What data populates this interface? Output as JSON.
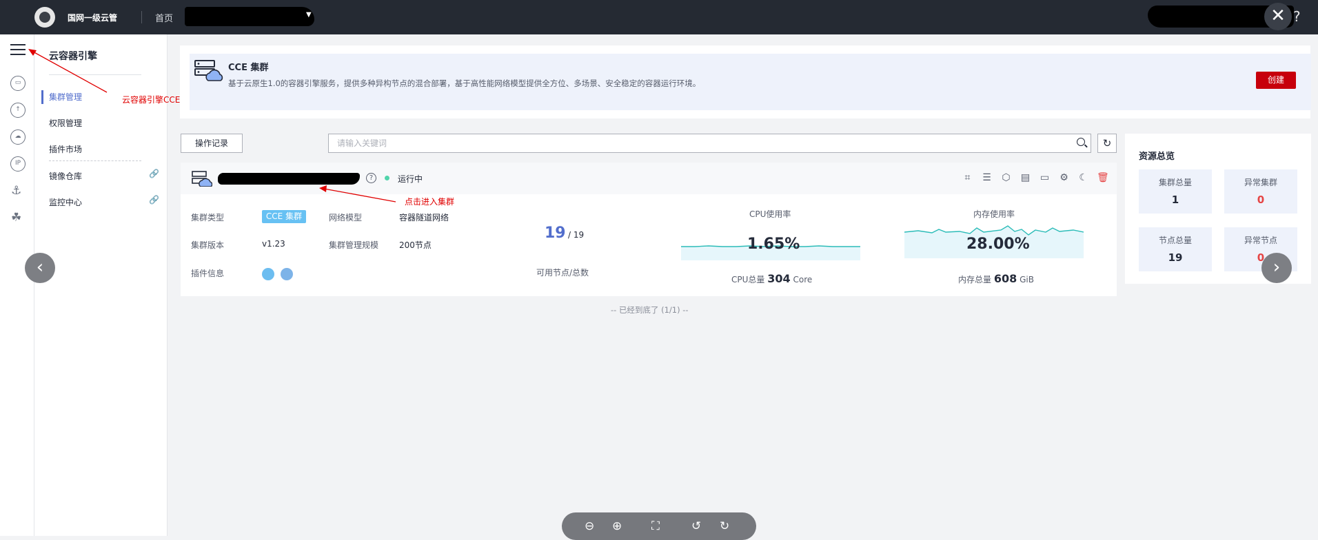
{
  "topbar": {
    "brand": "国网一级云管",
    "home": "首页"
  },
  "sidebar": {
    "title": "云容器引擎",
    "items": [
      {
        "label": "集群管理"
      },
      {
        "label": "权限管理"
      },
      {
        "label": "插件市场"
      },
      {
        "label": "镜像仓库"
      },
      {
        "label": "监控中心"
      }
    ]
  },
  "banner": {
    "title": "CCE 集群",
    "description": "基于云原生1.0的容器引擎服务，提供多种异构节点的混合部署，基于高性能网络模型提供全方位、多场景、安全稳定的容器运行环境。",
    "create_label": "创建"
  },
  "toolbar": {
    "log_label": "操作记录",
    "search_placeholder": "请输入关键词"
  },
  "cluster": {
    "status": "运行中",
    "fields": {
      "type_label": "集群类型",
      "type_value": "CCE 集群",
      "version_label": "集群版本",
      "version_value": "v1.23",
      "addons_label": "插件信息",
      "network_label": "网络模型",
      "network_value": "容器隧道网络",
      "scale_label": "集群管理规模",
      "scale_value": "200节点"
    },
    "nodes": {
      "available": "19",
      "total": "/ 19",
      "label": "可用节点/总数"
    },
    "cpu": {
      "title": "CPU使用率",
      "usage": "1.65%",
      "total_label": "CPU总量",
      "total_value": "304",
      "unit": "Core"
    },
    "memory": {
      "title": "内存使用率",
      "usage": "28.00%",
      "total_label": "内存总量",
      "total_value": "608",
      "unit": "GiB"
    }
  },
  "list_end": "-- 已经到底了 (1/1) --",
  "resources": {
    "title": "资源总览",
    "cluster_total_label": "集群总量",
    "cluster_total": "1",
    "cluster_abnormal_label": "异常集群",
    "cluster_abnormal": "0",
    "node_total_label": "节点总量",
    "node_total": "19",
    "node_abnormal_label": "异常节点",
    "node_abnormal": "0"
  },
  "annotations": {
    "cce": "云容器引擎CCE",
    "enter": "点击进入集群"
  },
  "colors": {
    "accent": "#526ecc",
    "danger": "#c7000b",
    "running": "#50d4ab",
    "sparkline": "#2bbcb8"
  }
}
